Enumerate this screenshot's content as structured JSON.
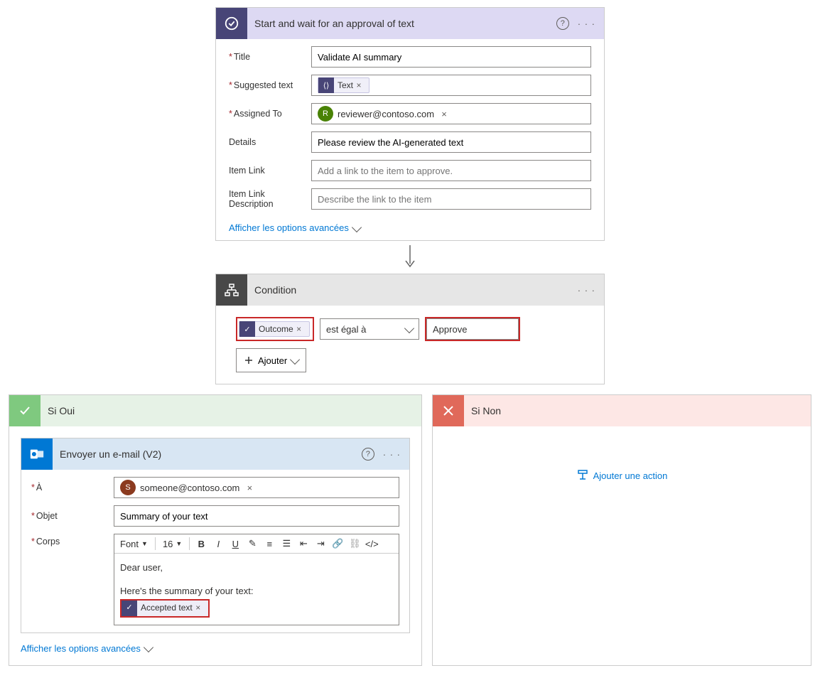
{
  "approval": {
    "title": "Start and wait for an approval of text",
    "fields": {
      "title_label": "Title",
      "title_value": "Validate AI summary",
      "suggested_label": "Suggested text",
      "suggested_token": "Text",
      "assigned_label": "Assigned To",
      "assigned_value": "reviewer@contoso.com",
      "assigned_initial": "R",
      "details_label": "Details",
      "details_value": "Please review the AI-generated text",
      "itemlink_label": "Item Link",
      "itemlink_placeholder": "Add a link to the item to approve.",
      "itemlinkdesc_label": "Item Link Description",
      "itemlinkdesc_placeholder": "Describe the link to the item"
    },
    "advanced": "Afficher les options avancées"
  },
  "condition": {
    "title": "Condition",
    "left_token": "Outcome",
    "operator": "est égal à",
    "right_value": "Approve",
    "add_button": "Ajouter"
  },
  "branches": {
    "yes_title": "Si Oui",
    "no_title": "Si Non",
    "add_action": "Ajouter une action"
  },
  "email": {
    "title": "Envoyer un e-mail (V2)",
    "to_label": "À",
    "to_value": "someone@contoso.com",
    "to_initial": "S",
    "subject_label": "Objet",
    "subject_value": "Summary of your text",
    "body_label": "Corps",
    "font_label": "Font",
    "font_size": "16",
    "body_line1": "Dear user,",
    "body_line2": "Here's the summary of your text:",
    "body_token": "Accepted text",
    "advanced": "Afficher les options avancées"
  }
}
